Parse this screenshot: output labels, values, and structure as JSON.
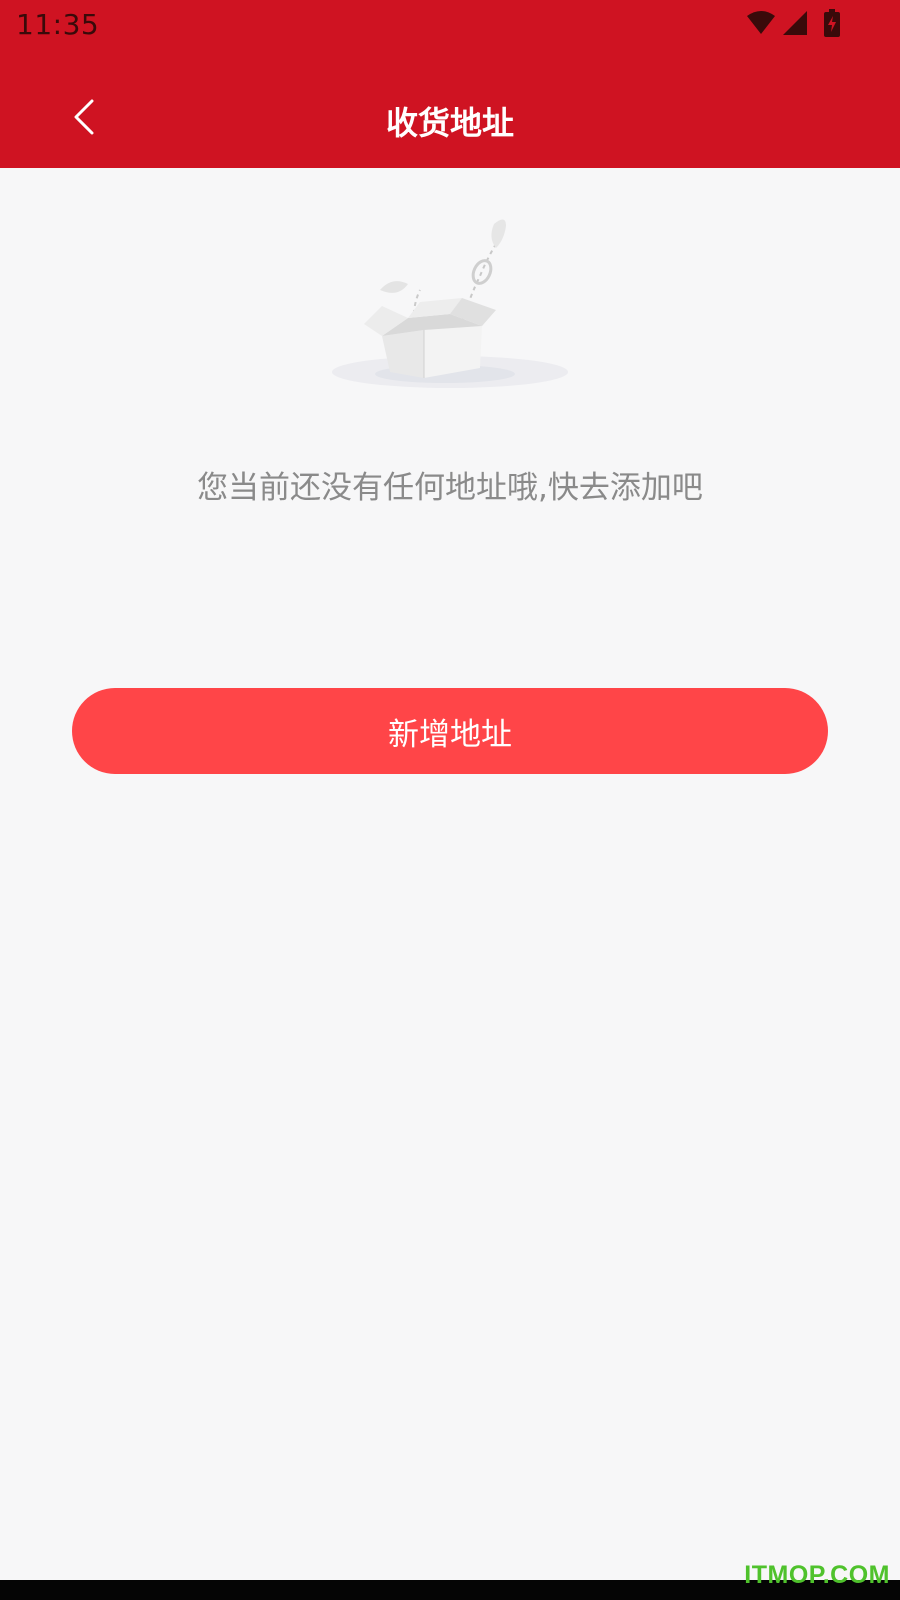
{
  "status_bar": {
    "time": "11:35",
    "icons": [
      "wifi-icon",
      "signal-icon",
      "battery-charging-icon"
    ]
  },
  "header": {
    "title": "收货地址",
    "back_icon": "chevron-left-icon"
  },
  "empty_state": {
    "illustration": "empty-box-icon",
    "message": "您当前还没有任何地址哦,快去添加吧"
  },
  "actions": {
    "add_address_label": "新增地址"
  },
  "watermark": {
    "text": "ITMOP.COM"
  },
  "colors": {
    "header_bg": "#cf1322",
    "button_bg": "#ff4548",
    "page_bg": "#f7f7f8",
    "message_text": "#8a8a8a",
    "watermark": "#4fc22c"
  }
}
